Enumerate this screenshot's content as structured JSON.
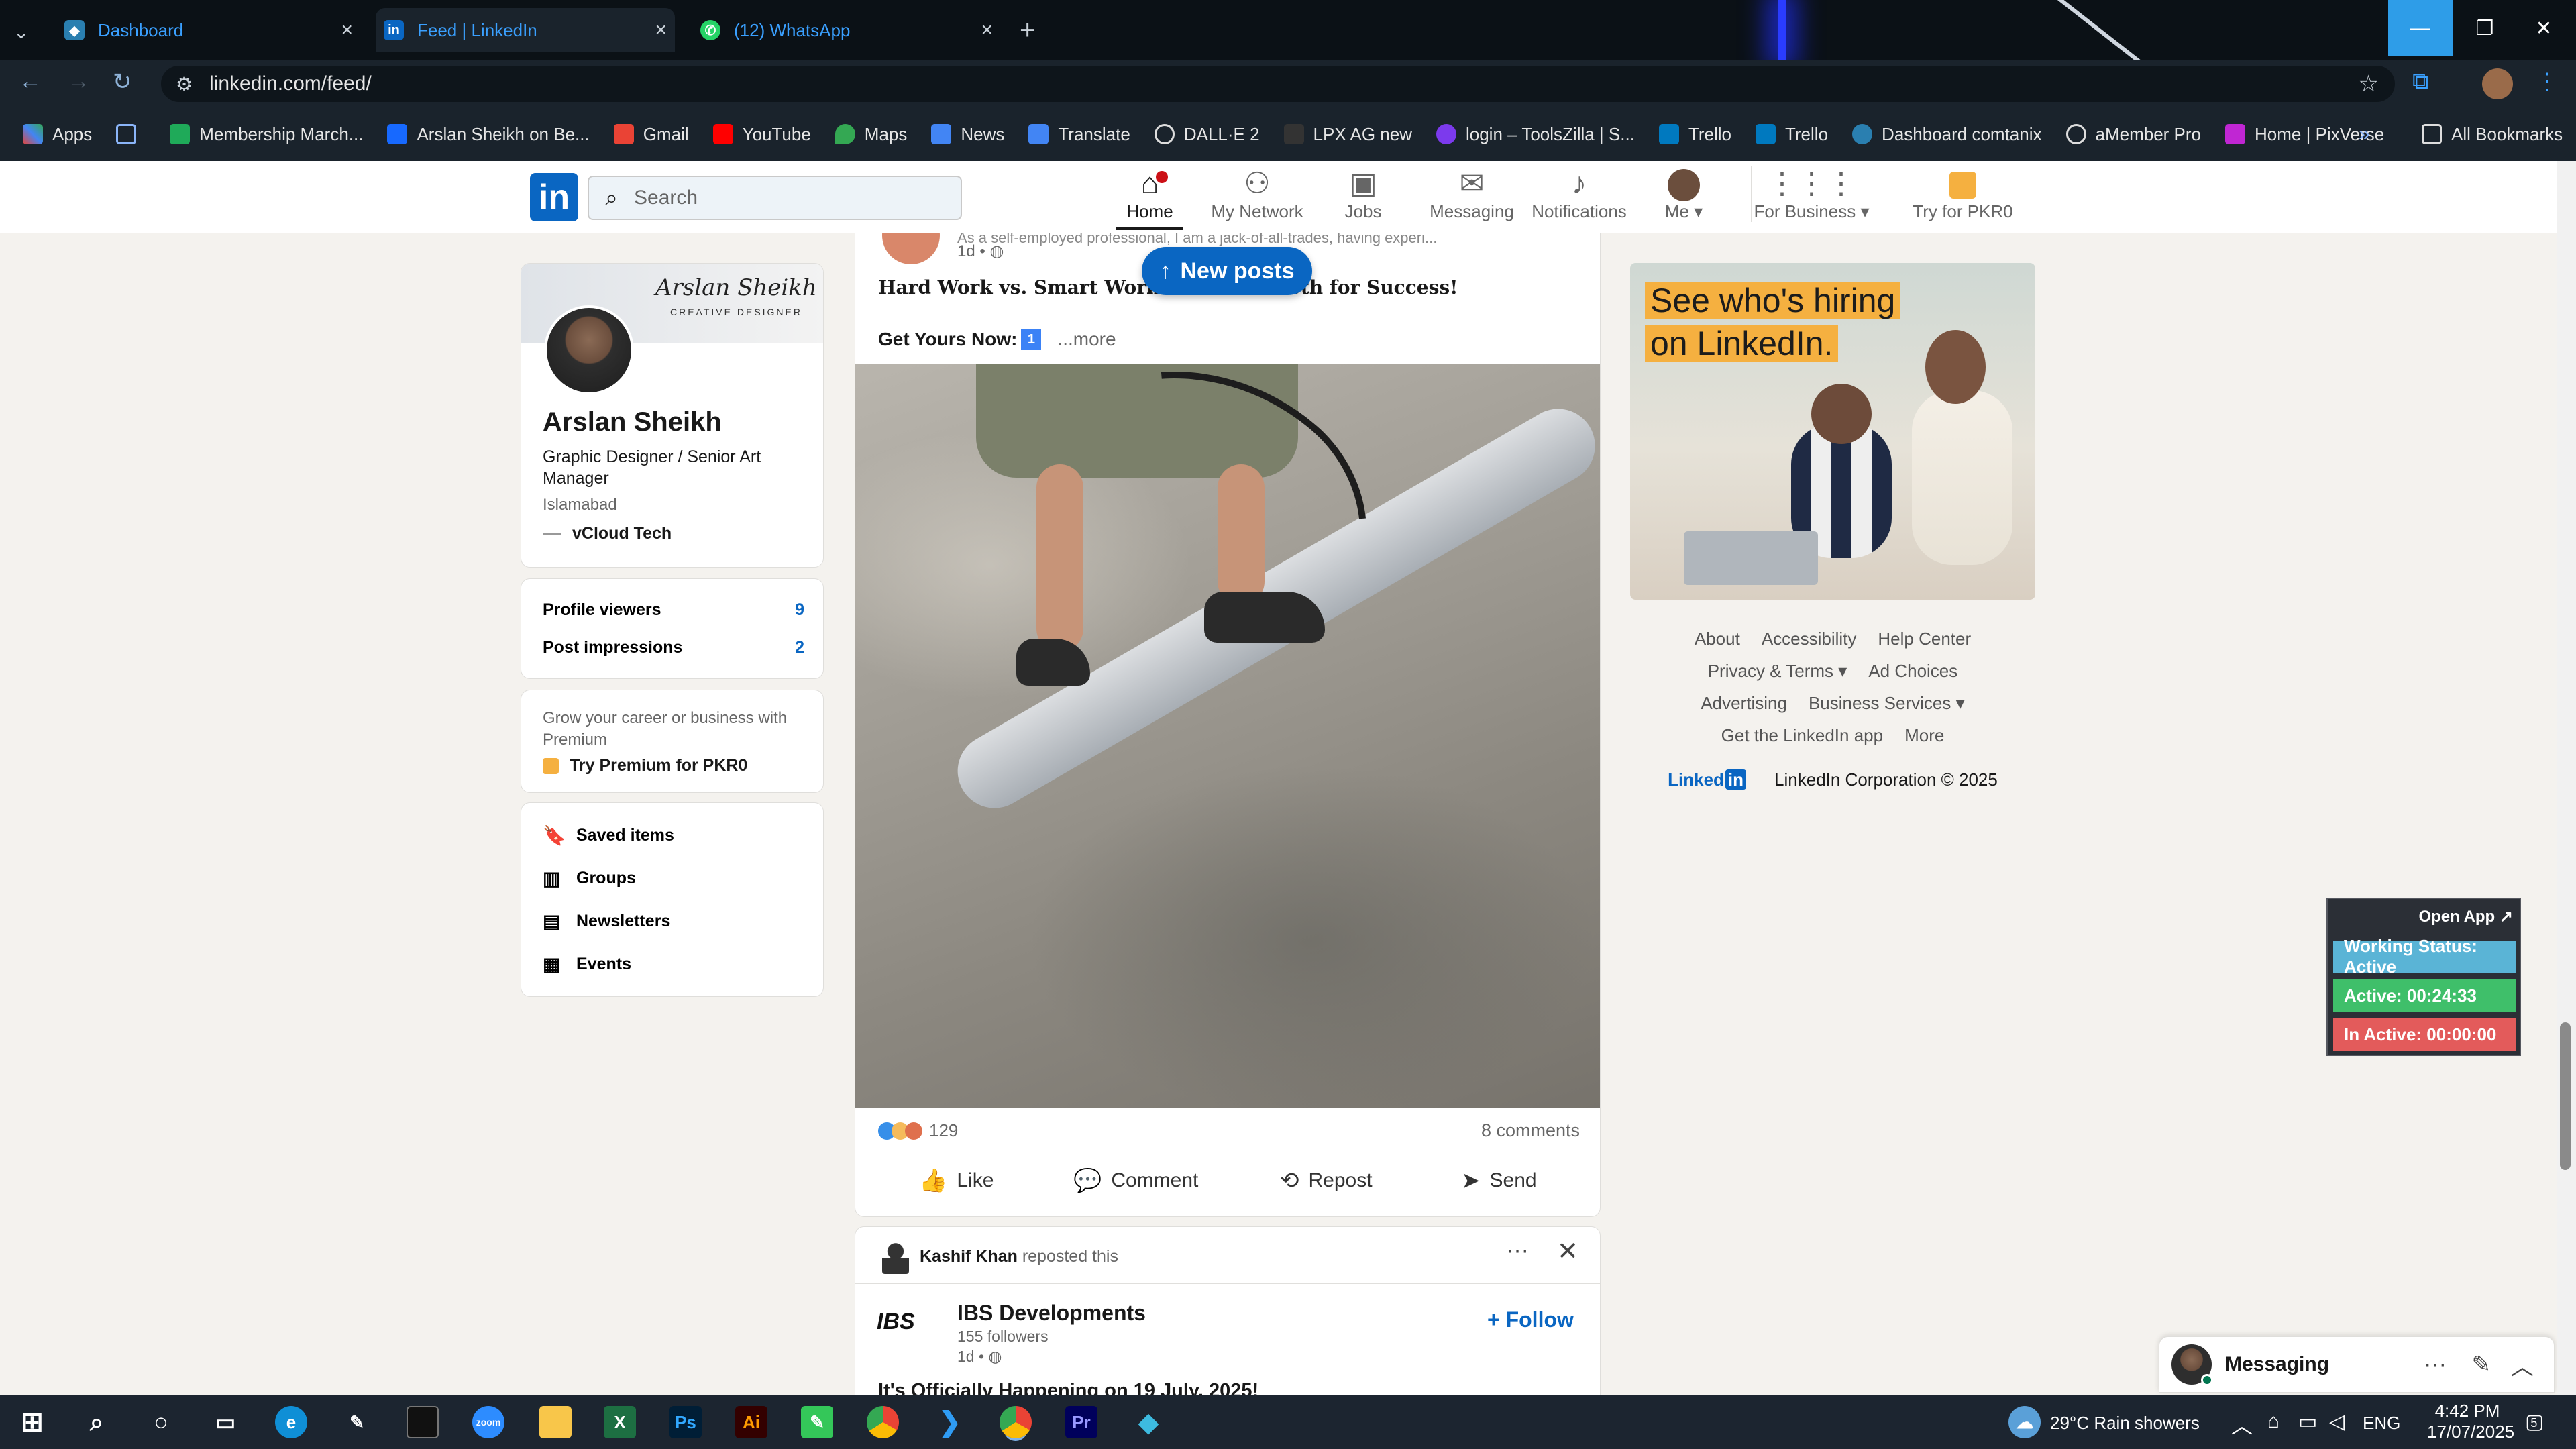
{
  "browser": {
    "tabs": [
      {
        "title": "Dashboard",
        "active": false
      },
      {
        "title": "Feed | LinkedIn",
        "active": true
      },
      {
        "title": "(12) WhatsApp",
        "active": false
      }
    ],
    "url": "linkedin.com/feed/",
    "bookmarks": [
      "Apps",
      "Membership March...",
      "Arslan Sheikh on Be...",
      "Gmail",
      "YouTube",
      "Maps",
      "News",
      "Translate",
      "DALL·E 2",
      "LPX AG new",
      "login – ToolsZilla | S...",
      "Trello",
      "Trello",
      "Dashboard comtanix",
      "aMember Pro",
      "Home | PixVerse"
    ],
    "all_bookmarks": "All Bookmarks"
  },
  "linkedin_header": {
    "search_placeholder": "Search",
    "nav": [
      {
        "label": "Home",
        "icon": "home-icon"
      },
      {
        "label": "My Network",
        "icon": "network-icon"
      },
      {
        "label": "Jobs",
        "icon": "briefcase-icon"
      },
      {
        "label": "Messaging",
        "icon": "messaging-icon"
      },
      {
        "label": "Notifications",
        "icon": "bell-icon"
      },
      {
        "label": "Me",
        "icon": "avatar"
      },
      {
        "label": "For Business",
        "icon": "grid-icon"
      },
      {
        "label": "Try for PKR0",
        "icon": "premium-icon"
      }
    ]
  },
  "profile": {
    "banner_name": "Arslan Sheikh",
    "banner_sub": "CREATIVE DESIGNER",
    "name": "Arslan Sheikh",
    "headline": "Graphic Designer / Senior Art Manager",
    "location": "Islamabad",
    "company": "vCloud Tech",
    "stats": [
      {
        "label": "Profile viewers",
        "value": "9"
      },
      {
        "label": "Post impressions",
        "value": "2"
      }
    ],
    "premium_text": "Grow your career or business with Premium",
    "premium_cta": "Try Premium for PKR0",
    "links": [
      "Saved items",
      "Groups",
      "Newsletters",
      "Events"
    ]
  },
  "post": {
    "author_subtitle": "As a self-employed professional, I am a jack-of-all-trades, having experi...",
    "time": "1d •",
    "headline": "Hard Work vs. Smart Work: Embrace Both for Success!",
    "cta": "Get Yours Now:",
    "more": "...more",
    "reactions_count": "129",
    "comments": "8 comments",
    "actions": [
      "Like",
      "Comment",
      "Repost",
      "Send"
    ]
  },
  "new_posts": "New posts",
  "next_post": {
    "reposter": "Kashif Khan",
    "reposted_text": "reposted this",
    "company": "IBS Developments",
    "followers": "155 followers",
    "time": "1d •",
    "follow": "+ Follow",
    "text": "It's Officially Happening on 19 July, 2025!"
  },
  "ad": {
    "line1": "See who's hiring",
    "line2": "on LinkedIn."
  },
  "footer": {
    "rows": [
      [
        "About",
        "Accessibility",
        "Help Center"
      ],
      [
        "Privacy & Terms ▾",
        "Ad Choices"
      ],
      [
        "Advertising",
        "Business Services ▾"
      ],
      [
        "Get the LinkedIn app",
        "More"
      ]
    ],
    "copyright": "LinkedIn Corporation © 2025"
  },
  "tracker": {
    "open_app": "Open App ↗",
    "status": "Working Status: Active",
    "active": "Active: 00:24:33",
    "inactive": "In Active: 00:00:00"
  },
  "messaging": {
    "label": "Messaging"
  },
  "taskbar": {
    "weather": "29°C  Rain showers",
    "lang": "ENG",
    "time": "4:42 PM",
    "date": "17/07/2025",
    "notif_count": "5"
  },
  "colors": {
    "linkedin_blue": "#0a66c2",
    "tracker_blue": "#5ab4d6",
    "tracker_green": "#3fbf6a",
    "tracker_red": "#e35b5b"
  }
}
